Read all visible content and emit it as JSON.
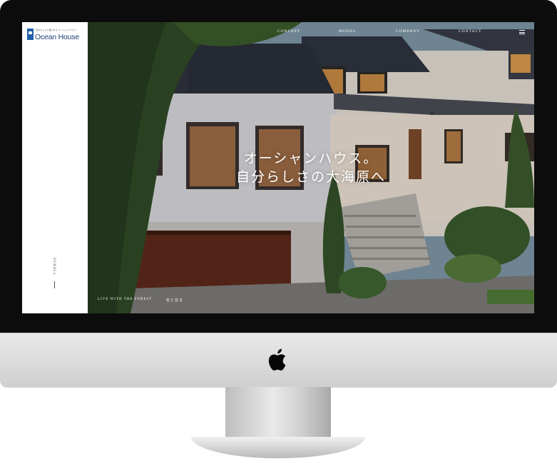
{
  "site": {
    "logo_tagline": "自分らしさに暮らせる オーシャンハウス",
    "logo_name": "Ocean House"
  },
  "nav": {
    "items": [
      {
        "label": "CONCEPT"
      },
      {
        "label": "MODEL"
      },
      {
        "label": "COMPANY"
      },
      {
        "label": "CONTACT"
      }
    ],
    "menu_icon": "hamburger-menu-icon"
  },
  "hero": {
    "catch_line1": "オーシャンハウス。",
    "catch_line2": "自分らしさの大海原へ",
    "footer_left": "LIVE WITH THE FOREST",
    "footer_right": "杜と在る"
  },
  "sidebar": {
    "scroll_label": "SCROLL"
  },
  "colors": {
    "brand_blue": "#1f5fa8",
    "logo_text": "#1d3f7a"
  }
}
